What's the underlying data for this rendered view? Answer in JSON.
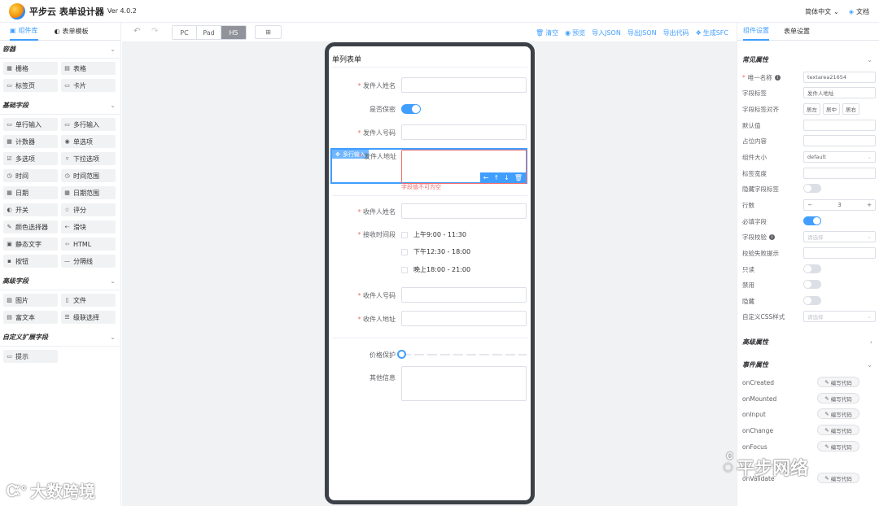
{
  "header": {
    "brand": "平步云 表单设计器",
    "version": "Ver 4.0.2",
    "language": "简体中文",
    "docs": "文档"
  },
  "left_panel": {
    "tabs": [
      {
        "label": "组件库",
        "active": true
      },
      {
        "label": "表单模板",
        "active": false
      }
    ],
    "groups": [
      {
        "title": "容器",
        "items": [
          {
            "label": "栅格",
            "icon": "grid-icon"
          },
          {
            "label": "表格",
            "icon": "table-icon"
          },
          {
            "label": "标签页",
            "icon": "tabs-icon"
          },
          {
            "label": "卡片",
            "icon": "card-icon"
          }
        ]
      },
      {
        "title": "基础字段",
        "items": [
          {
            "label": "单行输入",
            "icon": "input-icon"
          },
          {
            "label": "多行输入",
            "icon": "textarea-icon"
          },
          {
            "label": "计数器",
            "icon": "counter-icon"
          },
          {
            "label": "单选项",
            "icon": "radio-icon"
          },
          {
            "label": "多选项",
            "icon": "checkbox-icon"
          },
          {
            "label": "下拉选项",
            "icon": "select-icon"
          },
          {
            "label": "时间",
            "icon": "time-icon"
          },
          {
            "label": "时间范围",
            "icon": "time-range-icon"
          },
          {
            "label": "日期",
            "icon": "date-icon"
          },
          {
            "label": "日期范围",
            "icon": "date-range-icon"
          },
          {
            "label": "开关",
            "icon": "switch-icon"
          },
          {
            "label": "评分",
            "icon": "star-icon"
          },
          {
            "label": "颜色选择器",
            "icon": "color-picker-icon"
          },
          {
            "label": "滑块",
            "icon": "slider-icon"
          },
          {
            "label": "静态文字",
            "icon": "static-text-icon"
          },
          {
            "label": "HTML",
            "icon": "html-icon"
          },
          {
            "label": "按钮",
            "icon": "button-icon"
          },
          {
            "label": "分隔线",
            "icon": "divider-icon"
          }
        ]
      },
      {
        "title": "高级字段",
        "items": [
          {
            "label": "图片",
            "icon": "picture-icon"
          },
          {
            "label": "文件",
            "icon": "file-icon"
          },
          {
            "label": "富文本",
            "icon": "rich-text-icon"
          },
          {
            "label": "级联选择",
            "icon": "cascader-icon"
          }
        ]
      },
      {
        "title": "自定义扩展字段",
        "items": [
          {
            "label": "提示",
            "icon": "alert-icon"
          }
        ]
      }
    ]
  },
  "toolbar": {
    "devices": [
      {
        "label": "PC",
        "active": false
      },
      {
        "label": "Pad",
        "active": false
      },
      {
        "label": "H5",
        "active": true
      }
    ],
    "actions": [
      "清空",
      "预览",
      "导入JSON",
      "导出JSON",
      "导出代码",
      "生成SFC"
    ]
  },
  "form": {
    "title": "单列表单",
    "sender_name": "发件人姓名",
    "confidential": "是否保密",
    "sender_phone": "发件人号码",
    "sender_address": "发件人地址",
    "drag_tag": "多行输入",
    "error": "字段值不可为空",
    "receiver_name": "收件人姓名",
    "receive_time": "接收时间段",
    "time_options": [
      "上午9:00 - 11:30",
      "下午12:30 - 18:00",
      "晚上18:00 - 21:00"
    ],
    "receiver_phone": "收件人号码",
    "receiver_address": "收件人地址",
    "price_protect": "价格保护",
    "other_info": "其他信息"
  },
  "right_panel": {
    "tabs": [
      {
        "label": "组件设置",
        "active": true
      },
      {
        "label": "表单设置",
        "active": false
      }
    ],
    "common_title": "常见属性",
    "unique_name_label": "唯一名称",
    "unique_name_value": "textarea21654",
    "field_label_label": "字段标签",
    "field_label_value": "发件人地址",
    "align_label": "字段标签对齐",
    "align_options": [
      "居左",
      "居中",
      "居右"
    ],
    "default_label": "默认值",
    "placeholder_label": "占位内容",
    "size_label": "组件大小",
    "size_value": "default",
    "label_width_label": "标签宽度",
    "hide_label_label": "隐藏字段标签",
    "rows_label": "行数",
    "rows_value": "3",
    "required_label": "必填字段",
    "validation_label": "字段校验",
    "validation_placeholder": "请选择",
    "validation_tip_label": "校验失败提示",
    "readonly_label": "只读",
    "disabled_label": "禁用",
    "hidden_label": "隐藏",
    "css_label": "自定义CSS样式",
    "css_placeholder": "请选择",
    "advanced_title": "高级属性",
    "events_title": "事件属性",
    "events": [
      "onCreated",
      "onMounted",
      "onInput",
      "onChange",
      "onFocus",
      "onValidate"
    ],
    "edit_code_label": "编写代码"
  },
  "watermarks": {
    "left": "大数跨境",
    "right": "平步网络"
  }
}
